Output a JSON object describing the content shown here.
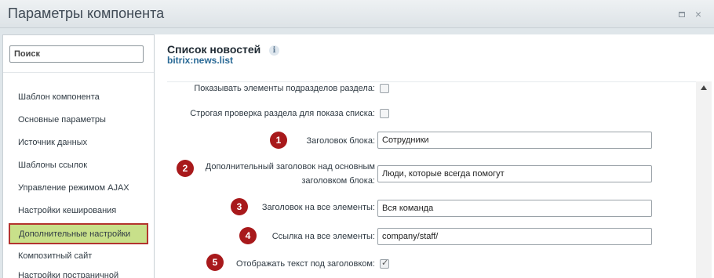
{
  "window": {
    "title": "Параметры компонента",
    "maximize_icon": "maximize-icon",
    "close_label": "×"
  },
  "sidebar": {
    "search_placeholder": "Поиск",
    "items": [
      {
        "label": "Шаблон компонента"
      },
      {
        "label": "Основные параметры"
      },
      {
        "label": "Источник данных"
      },
      {
        "label": "Шаблоны ссылок"
      },
      {
        "label": "Управление режимом AJAX"
      },
      {
        "label": "Настройки кеширования"
      },
      {
        "label": "Дополнительные настройки",
        "active": true
      },
      {
        "label": "Композитный сайт"
      },
      {
        "label": "Настройки постраничной"
      }
    ]
  },
  "header": {
    "title": "Список новостей",
    "subtitle": "bitrix:news.list",
    "info_icon": "i"
  },
  "form": {
    "rows": [
      {
        "label": "Показывать элементы подразделов раздела:",
        "type": "checkbox",
        "checked": false
      },
      {
        "label": "Строгая проверка раздела для показа списка:",
        "type": "checkbox",
        "checked": false
      },
      {
        "badge": "1",
        "label": "Заголовок блока:",
        "type": "text",
        "value": "Сотрудники"
      },
      {
        "badge": "2",
        "label": "Дополнительный заголовок над основным заголовком блока:",
        "type": "text",
        "value": "Люди, которые всегда помогут"
      },
      {
        "badge": "3",
        "label": "Заголовок на все элементы:",
        "type": "text",
        "value": "Вся команда"
      },
      {
        "badge": "4",
        "label": "Ссылка на все элементы:",
        "type": "text",
        "value": "company/staff/"
      },
      {
        "badge": "5",
        "label": "Отображать текст под заголовком:",
        "type": "checkbox",
        "checked": true
      }
    ]
  },
  "colors": {
    "active_item_bg": "#c8e08a",
    "active_item_border": "#b3342e",
    "badge": "#a8191b",
    "subtitle": "#2a6a96"
  }
}
